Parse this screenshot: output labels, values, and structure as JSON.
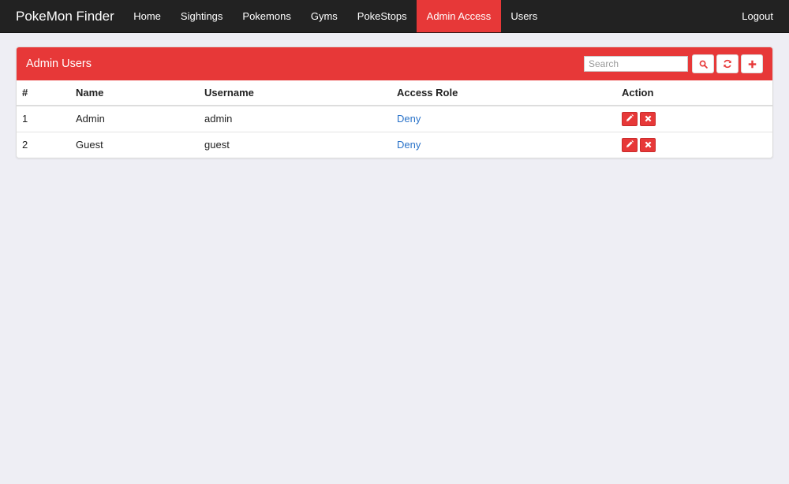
{
  "navbar": {
    "brand": "PokeMon Finder",
    "items": [
      {
        "label": "Home",
        "active": false
      },
      {
        "label": "Sightings",
        "active": false
      },
      {
        "label": "Pokemons",
        "active": false
      },
      {
        "label": "Gyms",
        "active": false
      },
      {
        "label": "PokeStops",
        "active": false
      },
      {
        "label": "Admin Access",
        "active": true
      },
      {
        "label": "Users",
        "active": false
      }
    ],
    "logout": "Logout"
  },
  "panel": {
    "title": "Admin Users",
    "search_placeholder": "Search",
    "search_value": "",
    "tools": [
      "search-icon",
      "refresh-icon",
      "plus-icon"
    ]
  },
  "table": {
    "headers": [
      "#",
      "Name",
      "Username",
      "Access Role",
      "Action"
    ],
    "rows": [
      {
        "num": "1",
        "name": "Admin",
        "username": "admin",
        "role": "Deny"
      },
      {
        "num": "2",
        "name": "Guest",
        "username": "guest",
        "role": "Deny"
      }
    ],
    "row_actions": [
      "pencil-icon",
      "times-icon"
    ]
  },
  "colors": {
    "accent": "#e73838",
    "navbar": "#222222",
    "background": "#eeeef4",
    "link": "#2a73c9"
  }
}
